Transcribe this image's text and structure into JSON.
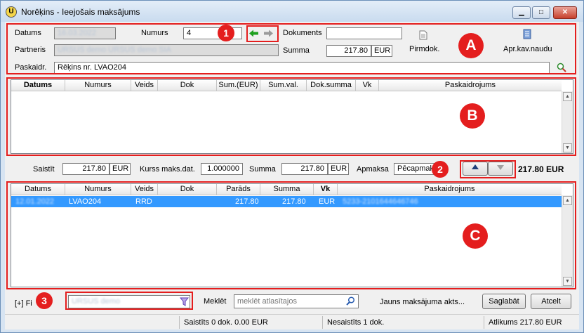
{
  "window": {
    "title": "Norēķins - Ieejošais maksājums",
    "app_icon": "U"
  },
  "header": {
    "datums_label": "Datums",
    "datums_value": "16.03.2022",
    "numurs_label": "Numurs",
    "numurs_value": "4",
    "dokuments_label": "Dokuments",
    "dokuments_value": "",
    "partneris_label": "Partneris",
    "partneris_value": "URSUS demo URSUS demo SIA",
    "summa_label": "Summa",
    "summa_value": "217.80",
    "summa_currency": "EUR",
    "pirmdok_label": "Pirmdok.",
    "aprkav_label": "Apr.kav.naudu",
    "paskaidr_label": "Paskaidr.",
    "paskaidr_value": "Rēķins nr. LVAO204"
  },
  "grid_b": {
    "columns": [
      "Datums",
      "Numurs",
      "Veids",
      "Dok",
      "Sum.(EUR)",
      "Sum.val.",
      "Dok.summa",
      "Vk",
      "Paskaidrojums"
    ]
  },
  "mid": {
    "saistit_label": "Saistīt",
    "saistit_value": "217.80",
    "saistit_currency": "EUR",
    "kurss_label": "Kurss maks.dat.",
    "kurss_value": "1.000000",
    "summa_label": "Summa",
    "summa_value": "217.80",
    "summa_currency": "EUR",
    "apmaksa_label": "Apmaksa",
    "apmaksa_value": "Pēcapmaksa",
    "total": "217.80 EUR"
  },
  "grid_c": {
    "columns": [
      "Datums",
      "Numurs",
      "Veids",
      "Dok",
      "Parāds",
      "Summa",
      "Vk",
      "Paskaidrojums"
    ],
    "rows": [
      {
        "datums": "12.01.2022",
        "numurs": "LVAO204",
        "veids": "RRD",
        "dok": "",
        "parads": "217.80",
        "summa": "217.80",
        "vk": "EUR",
        "paskaidrojums": "5233-2101644646746"
      }
    ]
  },
  "bottom": {
    "filter_label": "[+] Fi",
    "filter_value": "URSUS demo",
    "search_label": "Meklēt",
    "search_placeholder": "meklēt atlasītajos",
    "new_act_link": "Jauns maksājuma akts...",
    "save_button": "Saglabāt",
    "cancel_button": "Atcelt"
  },
  "status": {
    "saistits": "Saistīts 0 dok. 0.00 EUR",
    "nesaistits": "Nesaistīts 1 dok.",
    "atlikums": "Atlikums 217.80 EUR"
  },
  "annotations": {
    "b1": "1",
    "b2": "2",
    "b3": "3",
    "a": "A",
    "b": "B",
    "c": "C"
  },
  "colors": {
    "accent_red": "#e41e1e",
    "selection_blue": "#3399ff",
    "arrow_green": "#1ea01e"
  },
  "icons": [
    "app-icon",
    "arrow-left-icon",
    "arrow-right-icon",
    "document-icon",
    "calculator-icon",
    "search-icon",
    "arrow-up-icon",
    "arrow-down-icon",
    "filter-icon"
  ]
}
